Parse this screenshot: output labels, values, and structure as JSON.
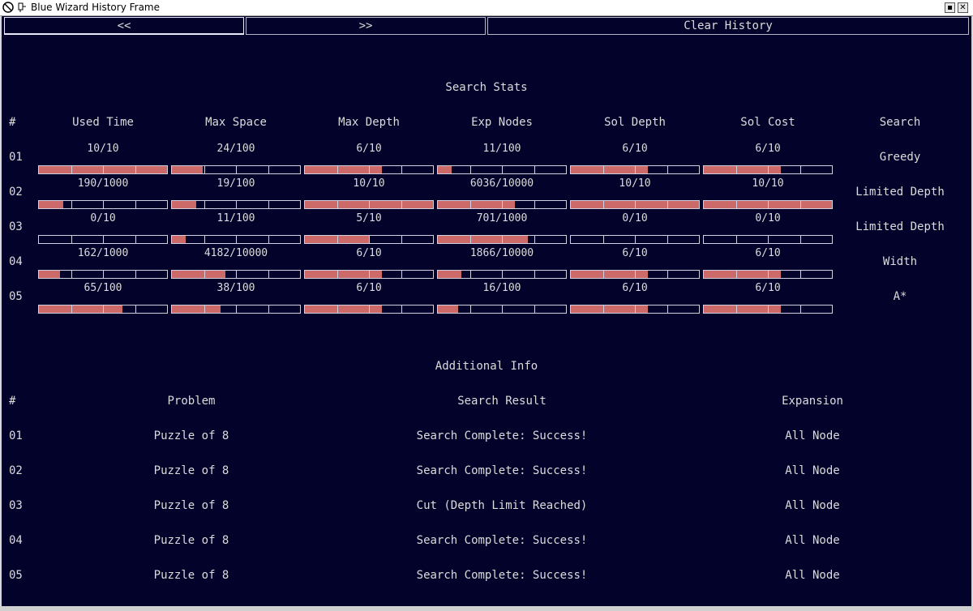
{
  "window": {
    "title": "Blue Wizard History Frame",
    "minimize_glyph": "▪",
    "close_glyph": "✕"
  },
  "toolbar": {
    "prev_label": "<<",
    "next_label": ">>",
    "clear_label": "Clear History"
  },
  "stats": {
    "title": "Search Stats",
    "headers": [
      "#",
      "Used Time",
      "Max Space",
      "Max Depth",
      "Exp Nodes",
      "Sol Depth",
      "Sol Cost",
      "Search"
    ],
    "rows": [
      {
        "num": "01",
        "search": "Greedy",
        "cells": [
          {
            "text": "10/10",
            "value": 10,
            "max": 10
          },
          {
            "text": "24/100",
            "value": 24,
            "max": 100
          },
          {
            "text": "6/10",
            "value": 6,
            "max": 10
          },
          {
            "text": "11/100",
            "value": 11,
            "max": 100
          },
          {
            "text": "6/10",
            "value": 6,
            "max": 10
          },
          {
            "text": "6/10",
            "value": 6,
            "max": 10
          }
        ]
      },
      {
        "num": "02",
        "search": "Limited Depth",
        "cells": [
          {
            "text": "190/1000",
            "value": 190,
            "max": 1000
          },
          {
            "text": "19/100",
            "value": 19,
            "max": 100
          },
          {
            "text": "10/10",
            "value": 10,
            "max": 10
          },
          {
            "text": "6036/10000",
            "value": 6036,
            "max": 10000
          },
          {
            "text": "10/10",
            "value": 10,
            "max": 10
          },
          {
            "text": "10/10",
            "value": 10,
            "max": 10
          }
        ]
      },
      {
        "num": "03",
        "search": "Limited Depth",
        "cells": [
          {
            "text": "0/10",
            "value": 0,
            "max": 10
          },
          {
            "text": "11/100",
            "value": 11,
            "max": 100
          },
          {
            "text": "5/10",
            "value": 5,
            "max": 10
          },
          {
            "text": "701/1000",
            "value": 701,
            "max": 1000
          },
          {
            "text": "0/10",
            "value": 0,
            "max": 10
          },
          {
            "text": "0/10",
            "value": 0,
            "max": 10
          }
        ]
      },
      {
        "num": "04",
        "search": "Width",
        "cells": [
          {
            "text": "162/1000",
            "value": 162,
            "max": 1000
          },
          {
            "text": "4182/10000",
            "value": 4182,
            "max": 10000
          },
          {
            "text": "6/10",
            "value": 6,
            "max": 10
          },
          {
            "text": "1866/10000",
            "value": 1866,
            "max": 10000
          },
          {
            "text": "6/10",
            "value": 6,
            "max": 10
          },
          {
            "text": "6/10",
            "value": 6,
            "max": 10
          }
        ]
      },
      {
        "num": "05",
        "search": "A*",
        "cells": [
          {
            "text": "65/100",
            "value": 65,
            "max": 100
          },
          {
            "text": "38/100",
            "value": 38,
            "max": 100
          },
          {
            "text": "6/10",
            "value": 6,
            "max": 10
          },
          {
            "text": "16/100",
            "value": 16,
            "max": 100
          },
          {
            "text": "6/10",
            "value": 6,
            "max": 10
          },
          {
            "text": "6/10",
            "value": 6,
            "max": 10
          }
        ]
      }
    ]
  },
  "info": {
    "title": "Additional Info",
    "headers": [
      "#",
      "Problem",
      "Search Result",
      "Expansion"
    ],
    "rows": [
      {
        "num": "01",
        "problem": "Puzzle of 8",
        "result": "Search Complete: Success!",
        "expansion": "All Node"
      },
      {
        "num": "02",
        "problem": "Puzzle of 8",
        "result": "Search Complete: Success!",
        "expansion": "All Node"
      },
      {
        "num": "03",
        "problem": "Puzzle of 8",
        "result": "Cut (Depth Limit Reached)",
        "expansion": "All Node"
      },
      {
        "num": "04",
        "problem": "Puzzle of 8",
        "result": "Search Complete: Success!",
        "expansion": "All Node"
      },
      {
        "num": "05",
        "problem": "Puzzle of 8",
        "result": "Search Complete: Success!",
        "expansion": "All Node"
      }
    ]
  },
  "colors": {
    "background": "#02022a",
    "bar_fill": "#cc6a6a",
    "text": "#dcdcdc"
  }
}
